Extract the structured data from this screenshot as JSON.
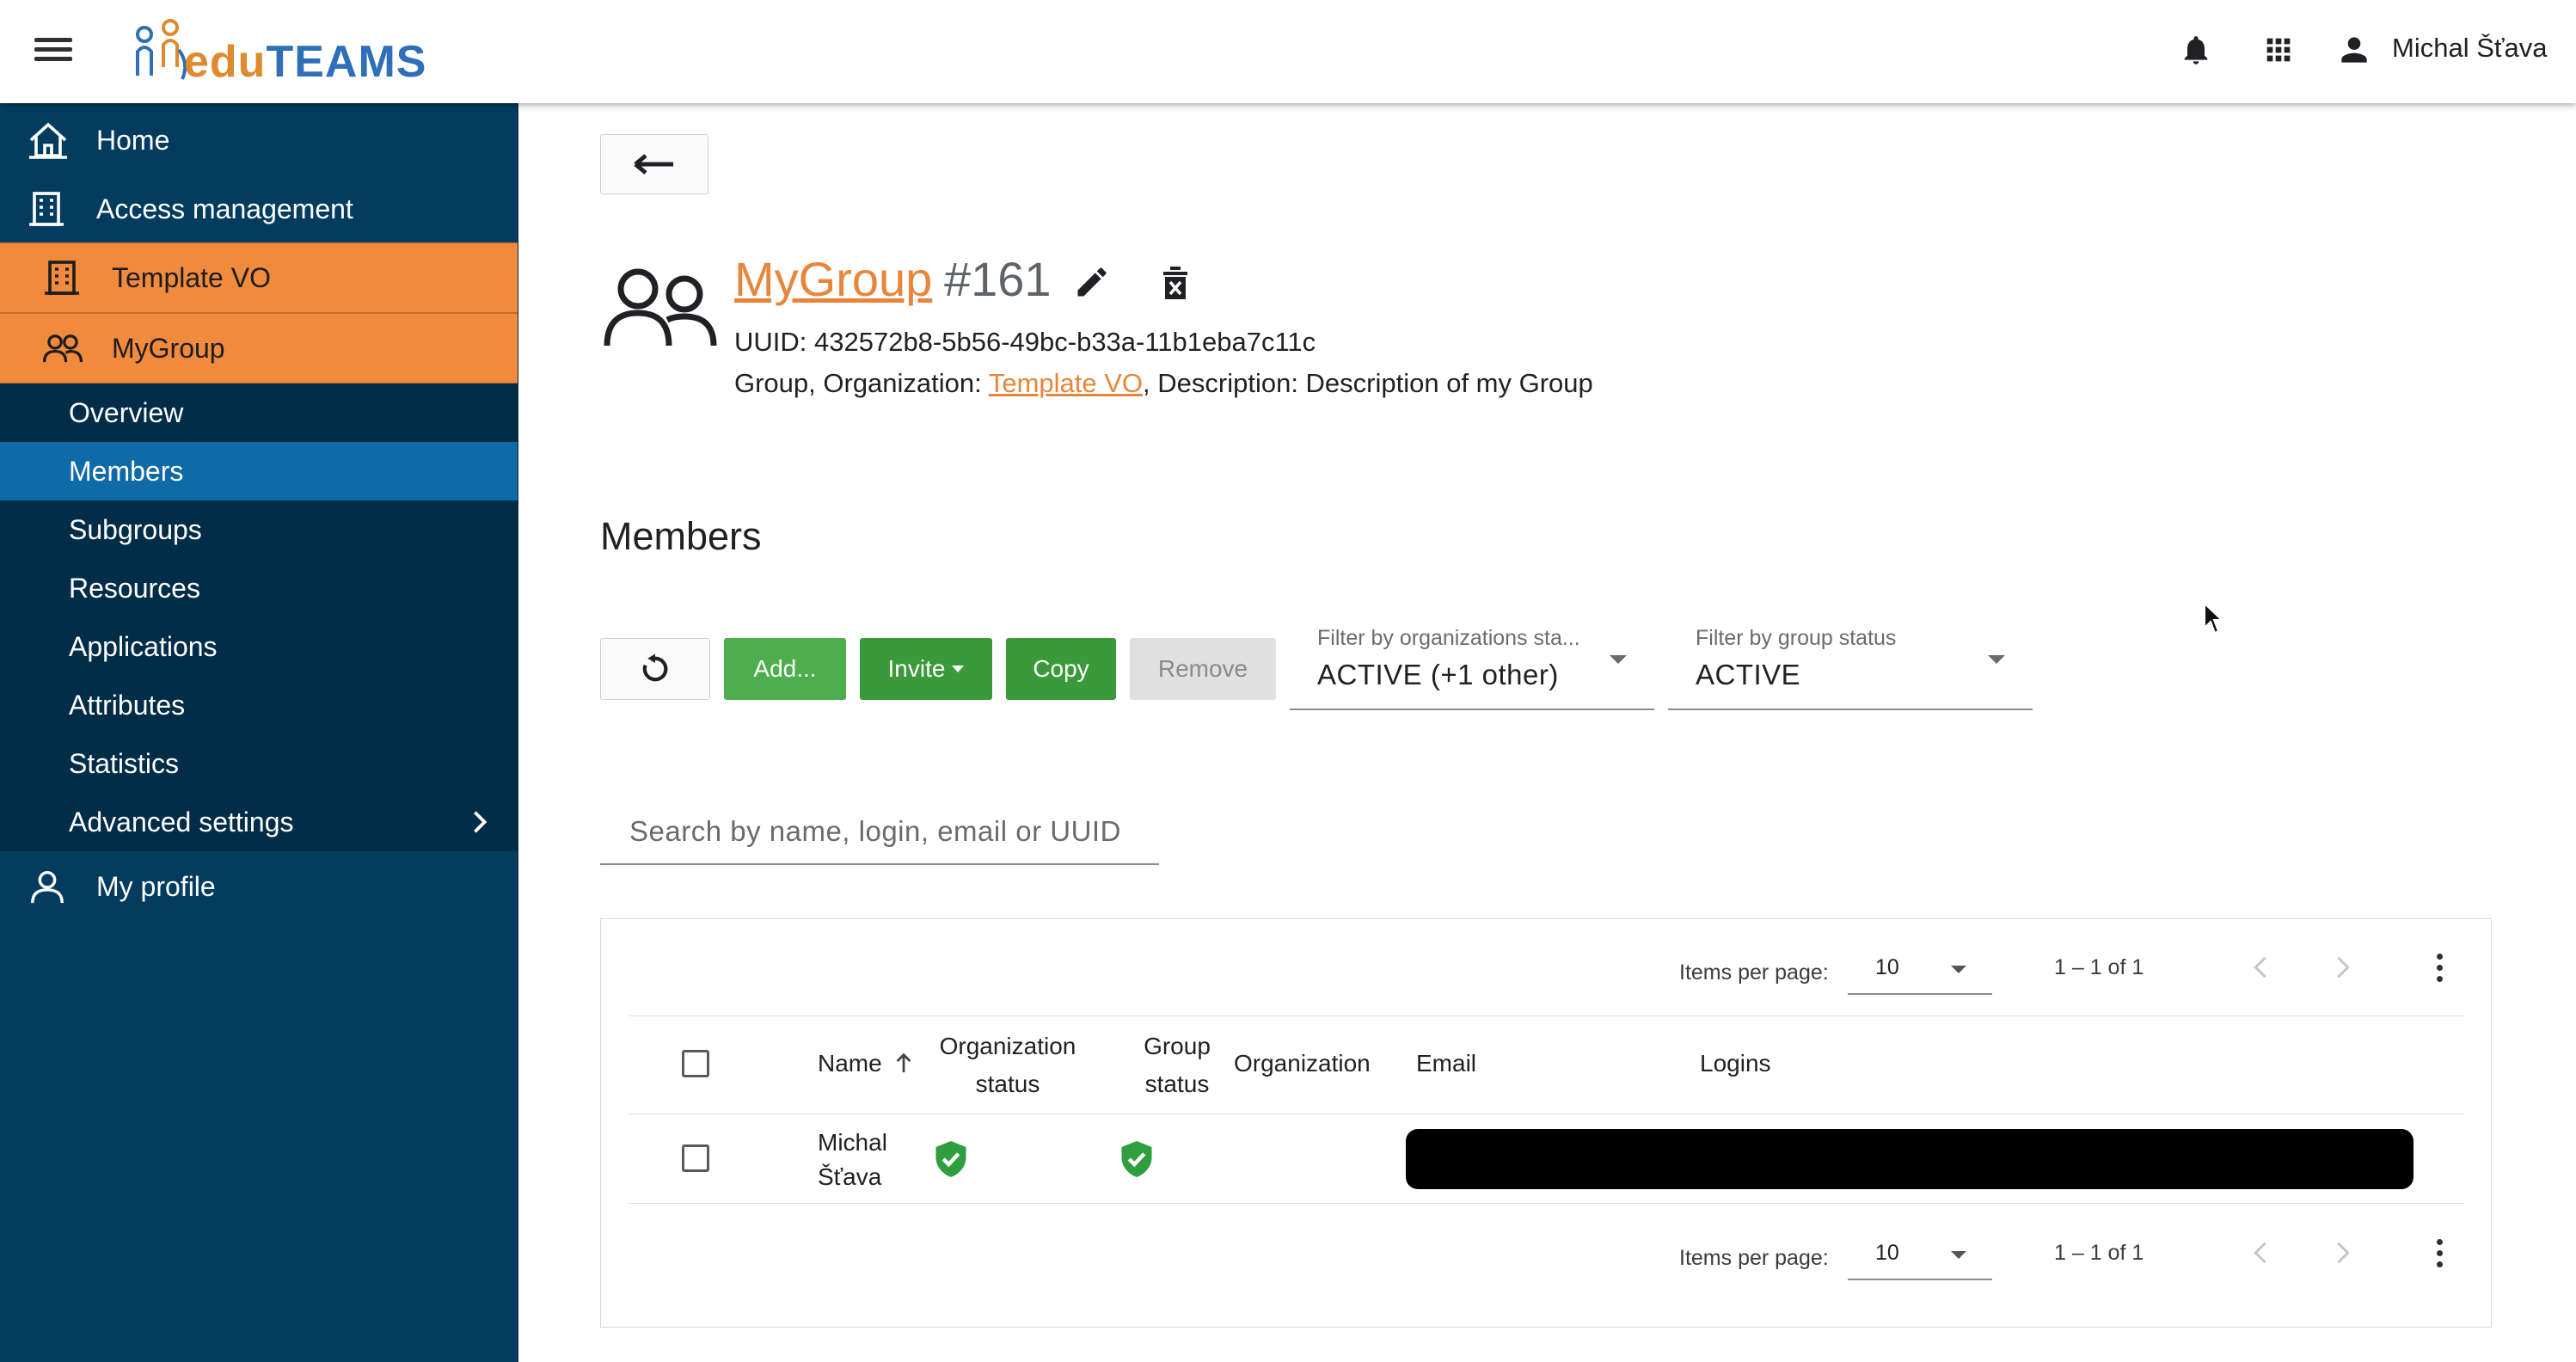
{
  "app": {
    "logo_text_1": "edu",
    "logo_text_2": "TEAMS"
  },
  "header": {
    "user_name": "Michal Šťava",
    "icons": [
      "menu-icon",
      "bell-icon",
      "apps-grid-icon",
      "user-icon"
    ]
  },
  "sidebar": {
    "items": [
      {
        "label": "Home",
        "icon": "home-icon"
      },
      {
        "label": "Access management",
        "icon": "building-icon"
      },
      {
        "label": "Template VO",
        "icon": "building-icon"
      },
      {
        "label": "MyGroup",
        "icon": "group-icon"
      },
      {
        "label": "Overview"
      },
      {
        "label": "Members"
      },
      {
        "label": "Subgroups"
      },
      {
        "label": "Resources"
      },
      {
        "label": "Applications"
      },
      {
        "label": "Attributes"
      },
      {
        "label": "Statistics"
      },
      {
        "label": "Advanced settings",
        "icon": "chevron-right-icon"
      },
      {
        "label": "My profile",
        "icon": "person-icon"
      }
    ]
  },
  "entity": {
    "name": "MyGroup",
    "id": "#161",
    "uuid_line": "UUID: 432572b8-5b56-49bc-b33a-11b1eba7c11c",
    "info_prefix": "Group, Organization: ",
    "org_link": "Template VO",
    "info_suffix": ", Description: Description of my Group"
  },
  "members": {
    "title": "Members",
    "buttons": {
      "add": "Add...",
      "invite": "Invite",
      "copy": "Copy",
      "remove": "Remove"
    },
    "filters": [
      {
        "label": "Filter by organizations sta...",
        "value": "ACTIVE (+1 other)"
      },
      {
        "label": "Filter by group status",
        "value": "ACTIVE"
      }
    ],
    "search_placeholder": "Search by name, login, email or UUID"
  },
  "table": {
    "items_per_page_label": "Items per page:",
    "items_per_page": "10",
    "range": "1 – 1 of 1",
    "columns": {
      "name": "Name",
      "org_status_1": "Organization",
      "org_status_2": "status",
      "group_status_1": "Group",
      "group_status_2": "status",
      "organization": "Organization",
      "email": "Email",
      "logins": "Logins"
    },
    "rows": [
      {
        "name_1": "Michal",
        "name_2": "Šťava",
        "org_status": "verified",
        "group_status": "verified",
        "email": "[redacted]"
      }
    ]
  },
  "colors": {
    "orange": "#f08a3c",
    "sidebar": "#033c5f",
    "active": "#0f6aa8",
    "green": "#4cae4c",
    "status_green": "#2e9e3e"
  }
}
